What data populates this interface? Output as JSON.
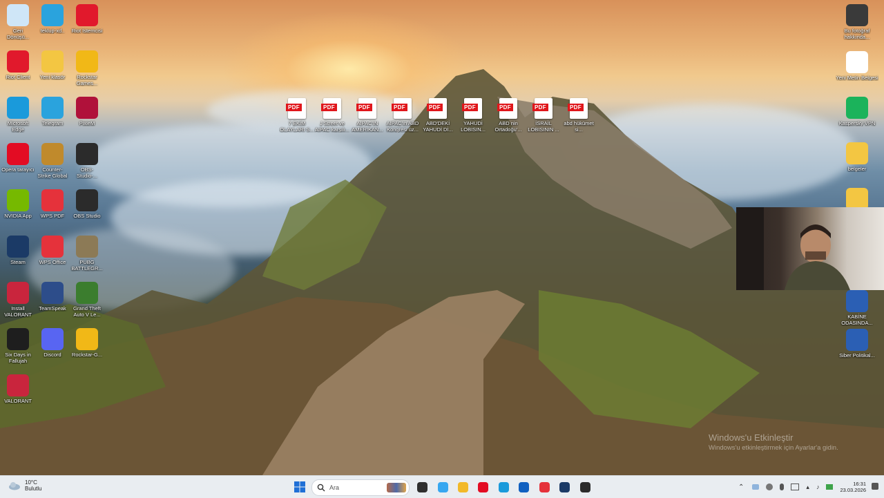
{
  "desktop_icons_left": [
    {
      "label": "Geri Dönüşü...",
      "icon": "recycle-bin-icon",
      "color": "#cfe6f7"
    },
    {
      "label": "teklup-xd..",
      "icon": "telegram-icon",
      "color": "#2aa3dd"
    },
    {
      "label": "Riot İstemcisi",
      "icon": "riot-icon",
      "color": "#e1192c"
    },
    {
      "label": "Riot Client",
      "icon": "riot-icon",
      "color": "#e1192c"
    },
    {
      "label": "Yeni klasör",
      "icon": "folder-icon",
      "color": "#f3c642"
    },
    {
      "label": "Rockstar Games...",
      "icon": "rockstar-icon",
      "color": "#f1b817"
    },
    {
      "label": "Microsoft Edge",
      "icon": "edge-icon",
      "color": "#1a9adb"
    },
    {
      "label": "Telegram",
      "icon": "telegram-icon",
      "color": "#2aa3dd"
    },
    {
      "label": "PixieM",
      "icon": "pixiem-icon",
      "color": "#b0113a"
    },
    {
      "label": "Opera tarayıcı",
      "icon": "opera-icon",
      "color": "#e30c23"
    },
    {
      "label": "Counter-Strike Global Offen...",
      "icon": "cs-icon",
      "color": "#c08a2c"
    },
    {
      "label": "OBS-Studio-...",
      "icon": "obs-icon",
      "color": "#2b2b2b"
    },
    {
      "label": "NVIDIA App",
      "icon": "nvidia-icon",
      "color": "#76b900"
    },
    {
      "label": "WPS PDF",
      "icon": "wps-pdf-icon",
      "color": "#e5323b"
    },
    {
      "label": "OBS Studio",
      "icon": "obs-icon",
      "color": "#2b2b2b"
    },
    {
      "label": "Steam",
      "icon": "steam-icon",
      "color": "#1b3a66"
    },
    {
      "label": "WPS Office",
      "icon": "wps-office-icon",
      "color": "#e5323b"
    },
    {
      "label": "PUBG BATTLEGR...",
      "icon": "pubg-icon",
      "color": "#8c7a56"
    },
    {
      "label": "Install VALORANT",
      "icon": "valorant-icon",
      "color": "#c9253d"
    },
    {
      "label": "TeamSpeak",
      "icon": "teamspeak-icon",
      "color": "#2d4d8a"
    },
    {
      "label": "Grand Theft Auto V Le...",
      "icon": "gta-icon",
      "color": "#3b7d2e"
    },
    {
      "label": "Six Days in Fallujah",
      "icon": "sixdays-icon",
      "color": "#1e1e1e"
    },
    {
      "label": "Discord",
      "icon": "discord-icon",
      "color": "#5865f2"
    },
    {
      "label": "Rockstar-G...",
      "icon": "rockstar-icon",
      "color": "#f1b817"
    },
    {
      "label": "VALORANT",
      "icon": "valorant-icon",
      "color": "#c9253d"
    }
  ],
  "pdf_files": [
    {
      "label": "7 EKİM OLAYLARI S..."
    },
    {
      "label": "J Street ve AIPAC karşılı..."
    },
    {
      "label": "AIPAC'IN AMERIKAN..."
    },
    {
      "label": "AIPAC'ın ABD Kongresi üz..."
    },
    {
      "label": "ABD'DEKİ YAHUDİ Dİ..."
    },
    {
      "label": "YAHUDİ LOBISIN..."
    },
    {
      "label": "ABD nin Ortadoğu'..."
    },
    {
      "label": "İSRAİL LOBISININ ..."
    },
    {
      "label": "abd hükümet si..."
    }
  ],
  "pdf_badge": "PDF",
  "desktop_icons_right": [
    {
      "label": "Bu fotoğraf hakkında...",
      "icon": "camera-icon",
      "color": "#3a3a3a"
    },
    {
      "label": "Yeni Metin Belgesi",
      "icon": "text-file-icon",
      "color": "#ffffff"
    },
    {
      "label": "Kaspersky VPN",
      "icon": "kaspersky-icon",
      "color": "#1bb35b"
    },
    {
      "label": "belgeler",
      "icon": "folder-icon",
      "color": "#f3c642"
    },
    {
      "label": "",
      "icon": "folder-icon",
      "color": "#f3c642"
    },
    {
      "label": "KABİNE ODASINDA...",
      "icon": "word-icon",
      "color": "#2b5fb4"
    },
    {
      "label": "Siber Politikal...",
      "icon": "word-icon",
      "color": "#2b5fb4"
    }
  ],
  "watermark": {
    "title": "Windows'u Etkinleştir",
    "subtitle": "Windows'u etkinleştirmek için Ayarlar'a gidin."
  },
  "taskbar": {
    "weather": {
      "temp": "10°C",
      "desc": "Bulutlu"
    },
    "search_placeholder": "Ara",
    "apps": [
      {
        "name": "start-button",
        "color": "#1f6fd6"
      },
      {
        "name": "task-view",
        "color": "#2f2f2f"
      },
      {
        "name": "copilot",
        "color": "#37a7f0"
      },
      {
        "name": "file-explorer",
        "color": "#f2b929"
      },
      {
        "name": "opera",
        "color": "#e30c23"
      },
      {
        "name": "edge",
        "color": "#1a9adb"
      },
      {
        "name": "store",
        "color": "#1060c0"
      },
      {
        "name": "wps",
        "color": "#e5323b"
      },
      {
        "name": "steam",
        "color": "#1b3a66"
      },
      {
        "name": "obs",
        "color": "#2b2b2b"
      }
    ],
    "clock": {
      "time": "16:31",
      "date": "23.03.2026"
    }
  }
}
